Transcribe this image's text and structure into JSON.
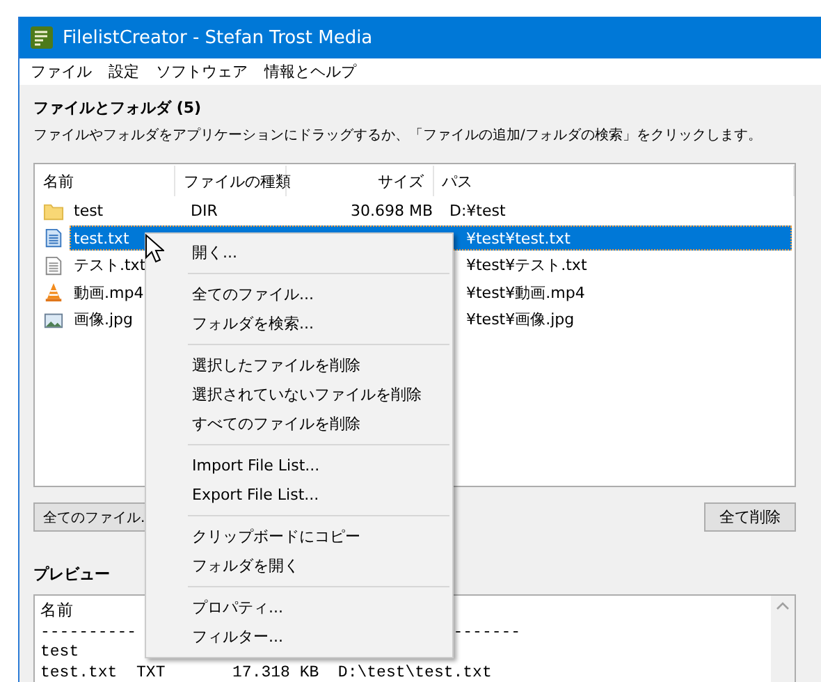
{
  "window": {
    "title": "FilelistCreator - Stefan Trost Media"
  },
  "menu_bar": [
    "ファイル",
    "設定",
    "ソフトウェア",
    "情報とヘルプ"
  ],
  "files_section": {
    "heading": "ファイルとフォルダ (5)",
    "hint": "ファイルやフォルダをアプリケーションにドラッグするか、「ファイルの追加/フォルダの検索」をクリックします。"
  },
  "file_list": {
    "columns": [
      "名前",
      "ファイルの種類",
      "サイズ",
      "パス"
    ],
    "rows": [
      {
        "kind": "folder",
        "name": "test",
        "type": "DIR",
        "size": "30.698 MB",
        "path": "D:¥test",
        "selected": false
      },
      {
        "kind": "text",
        "name": "test.txt",
        "path": "¥test¥test.txt",
        "selected": true
      },
      {
        "kind": "text",
        "name": "テスト.txt",
        "path": "¥test¥テスト.txt",
        "selected": false
      },
      {
        "kind": "video",
        "name": "動画.mp4",
        "path": "¥test¥動画.mp4",
        "selected": false
      },
      {
        "kind": "image",
        "name": "画像.jpg",
        "path": "¥test¥画像.jpg",
        "selected": false
      }
    ]
  },
  "buttons": {
    "left": "全てのファイル.",
    "right": "全て削除"
  },
  "preview": {
    "heading": "プレビュー",
    "lines": [
      {
        "left": "名前"
      },
      {
        "left": "----------",
        "right": "-------"
      },
      {
        "left": "test"
      },
      {
        "left": "test.txt  TXT       17.318 KB  D:\\test\\test.txt"
      }
    ]
  },
  "context_menu": [
    {
      "kind": "item",
      "label": "開く..."
    },
    {
      "kind": "separator"
    },
    {
      "kind": "item",
      "label": "全てのファイル..."
    },
    {
      "kind": "item",
      "label": "フォルダを検索..."
    },
    {
      "kind": "separator"
    },
    {
      "kind": "item",
      "label": "選択したファイルを削除"
    },
    {
      "kind": "item",
      "label": "選択されていないファイルを削除"
    },
    {
      "kind": "item",
      "label": "すべてのファイルを削除"
    },
    {
      "kind": "separator"
    },
    {
      "kind": "item",
      "label": "Import File List..."
    },
    {
      "kind": "item",
      "label": "Export File List..."
    },
    {
      "kind": "separator"
    },
    {
      "kind": "item",
      "label": "クリップボードにコピー"
    },
    {
      "kind": "item",
      "label": "フォルダを開く"
    },
    {
      "kind": "separator"
    },
    {
      "kind": "item",
      "label": "プロパティ..."
    },
    {
      "kind": "item",
      "label": "フィルター..."
    }
  ]
}
